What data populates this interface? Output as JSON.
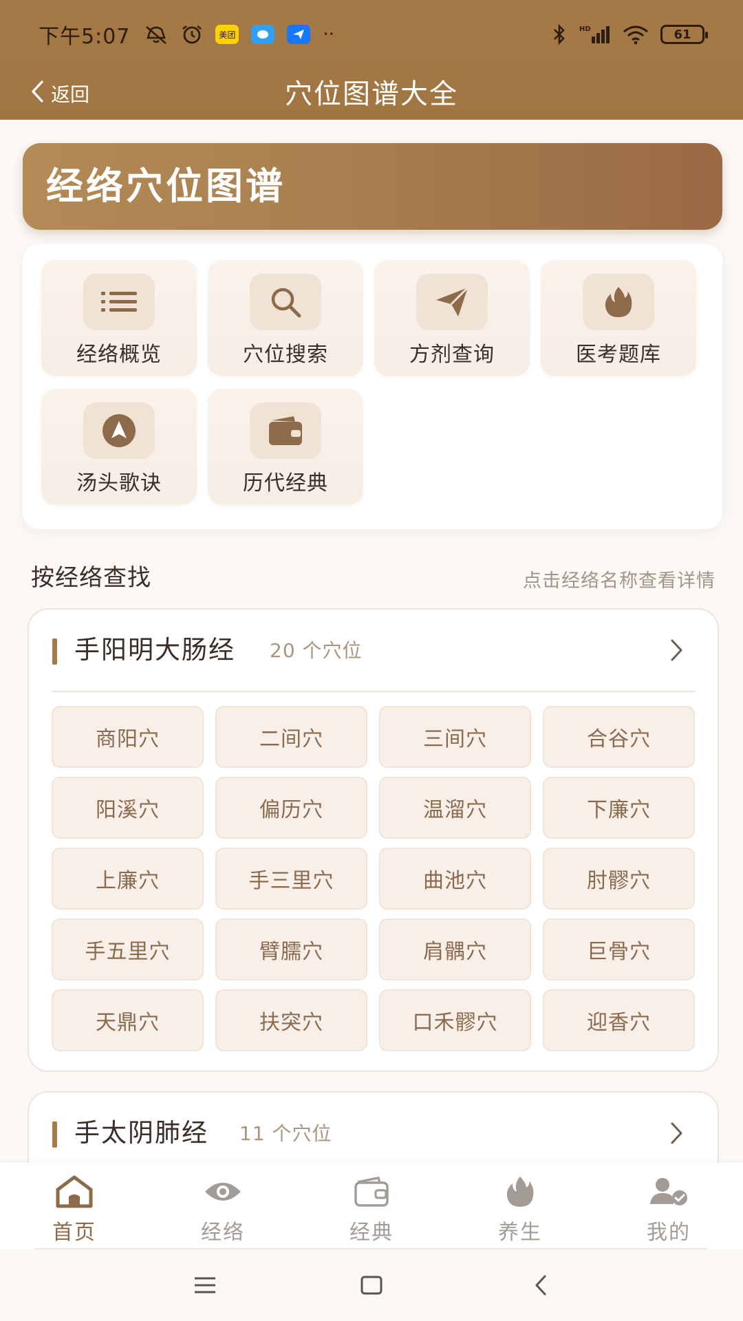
{
  "status_bar": {
    "time": "下午5:07",
    "meituan_badge": "美团",
    "network": "HD",
    "battery": "61"
  },
  "nav": {
    "back_label": "返回",
    "title": "穴位图谱大全"
  },
  "banner": {
    "title": "经络穴位图谱"
  },
  "features": [
    {
      "label": "经络概览",
      "icon": "list-icon"
    },
    {
      "label": "穴位搜索",
      "icon": "search-icon"
    },
    {
      "label": "方剂查询",
      "icon": "send-icon"
    },
    {
      "label": "医考题库",
      "icon": "flame-icon"
    },
    {
      "label": "汤头歌诀",
      "icon": "navigation-icon"
    },
    {
      "label": "历代经典",
      "icon": "wallet-icon"
    }
  ],
  "section": {
    "title": "按经络查找",
    "hint": "点击经络名称查看详情"
  },
  "meridians": [
    {
      "name": "手阳明大肠经",
      "count": "20",
      "count_unit": "个穴位",
      "points": [
        "商阳穴",
        "二间穴",
        "三间穴",
        "合谷穴",
        "阳溪穴",
        "偏历穴",
        "温溜穴",
        "下廉穴",
        "上廉穴",
        "手三里穴",
        "曲池穴",
        "肘髎穴",
        "手五里穴",
        "臂臑穴",
        "肩髃穴",
        "巨骨穴",
        "天鼎穴",
        "扶突穴",
        "口禾髎穴",
        "迎香穴"
      ]
    },
    {
      "name": "手太阴肺经",
      "count": "11",
      "count_unit": "个穴位",
      "points": []
    }
  ],
  "tabs": [
    {
      "label": "首页",
      "icon": "home-icon",
      "active": true
    },
    {
      "label": "经络",
      "icon": "eye-icon",
      "active": false
    },
    {
      "label": "经典",
      "icon": "wallet-icon",
      "active": false
    },
    {
      "label": "养生",
      "icon": "flame-icon",
      "active": false
    },
    {
      "label": "我的",
      "icon": "user-check-icon",
      "active": false
    }
  ],
  "colors": {
    "brand": "#a57a46",
    "brand_dark": "#8d6a49",
    "point_bg": "#f8f0e8",
    "point_text": "#8a6a4e",
    "inactive_tab": "#a39c96"
  }
}
